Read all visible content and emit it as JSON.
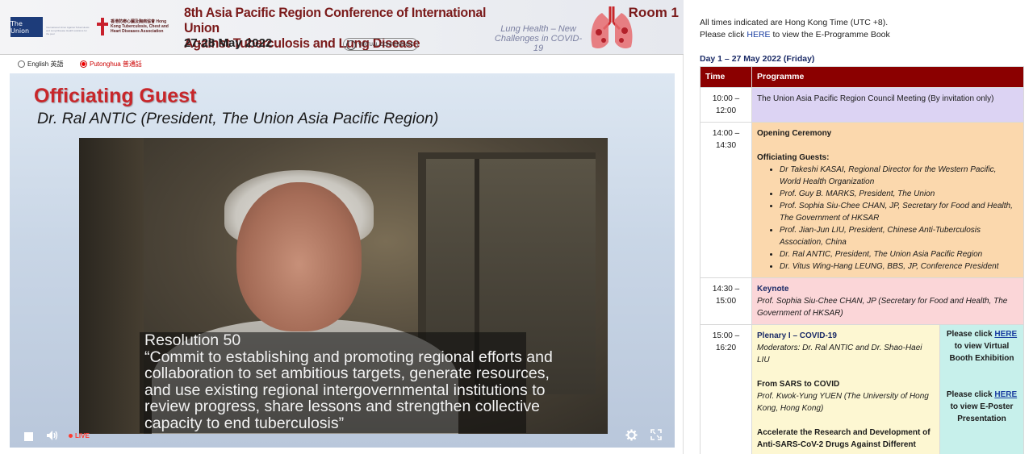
{
  "banner": {
    "union_logo": "The Union",
    "union_sub": "International Union Against Tuberculosis and Lung Disease Health solutions for the poor",
    "hk_text": "香港防癆心臟及胸病協會 Hong Kong Tuberculosis, Chest and Heart Diseases Association",
    "title_line1": "8th Asia Pacific Region Conference of International Union",
    "title_line2": "Against Tuberculosis and Lung Disease",
    "dates": "27-28 May 2022",
    "virtual_label": "VIRTUAL CONFERENCE",
    "tagline": "Lung Health – New Challenges in COVID-19",
    "room": "Room 1"
  },
  "language": {
    "options": [
      {
        "label": "English 英語",
        "selected": false
      },
      {
        "label": "Putonghua 普通話",
        "selected": true
      }
    ]
  },
  "video": {
    "heading": "Officiating Guest",
    "speaker": "Dr. Ral ANTIC (President, The Union Asia Pacific Region)",
    "caption_lines": [
      "Resolution 50",
      "“Commit to establishing and promoting regional efforts and",
      "collaboration to set ambitious targets, generate resources,",
      "and use existing regional intergovernmental institutions to",
      "review progress, share lessons and strengthen collective",
      "capacity to end tuberculosis”"
    ],
    "live_label": "LIVE",
    "icons": [
      "stop-icon",
      "volume-icon",
      "settings-icon",
      "fullscreen-icon"
    ]
  },
  "info": {
    "timezone_note": "All times indicated are Hong Kong Time (UTC +8).",
    "eprog_prefix": "Please click ",
    "eprog_link": "HERE",
    "eprog_suffix": " to view the E-Programme Book"
  },
  "schedule": {
    "day_title": "Day 1 – 27 May 2022 (Friday)",
    "headers": [
      "Time",
      "Programme"
    ],
    "rows": [
      {
        "time": "10:00 – 12:00",
        "title": "The Union Asia Pacific Region Council Meeting (By invitation only)"
      },
      {
        "time": "14:00 – 14:30",
        "title": "Opening Ceremony",
        "sub_heading": "Officiating Guests:",
        "guests": [
          "Dr Takeshi KASAI, Regional Director for the Western Pacific, World Health Organization",
          "Prof. Guy B. MARKS, President, The Union",
          "Prof. Sophia Siu-Chee CHAN, JP, Secretary for Food and Health, The Government of HKSAR",
          "Prof. Jian-Jun LIU, President, Chinese Anti-Tuberculosis Association, China",
          "Dr. Ral ANTIC, President, The Union Asia Pacific Region",
          "Dr. Vitus Wing-Hang LEUNG, BBS, JP, Conference President"
        ]
      },
      {
        "time": "14:30 – 15:00",
        "title": "Keynote",
        "detail": "Prof. Sophia Siu-Chee CHAN, JP (Secretary for Food and Health, The Government of HKSAR)"
      },
      {
        "time": "15:00 – 16:20",
        "title": "Plenary I – COVID-19",
        "moderators": "Moderators: Dr. Ral ANTIC and Dr. Shao-Haei LIU",
        "talk1_title": "From SARS to COVID",
        "talk1_speaker": "Prof. Kwok-Yung YUEN (The University of Hong Kong, Hong Kong)",
        "talk2_title": "Accelerate the Research and Development of Anti-SARS-CoV-2 Drugs Against Different",
        "side_booth_prefix": "Please click ",
        "side_booth_link": "HERE",
        "side_booth_suffix": "to view  Virtual Booth Exhibition",
        "side_poster_prefix": "Please click ",
        "side_poster_link": "HERE",
        "side_poster_suffix": "to view E-Poster Presentation"
      }
    ]
  }
}
